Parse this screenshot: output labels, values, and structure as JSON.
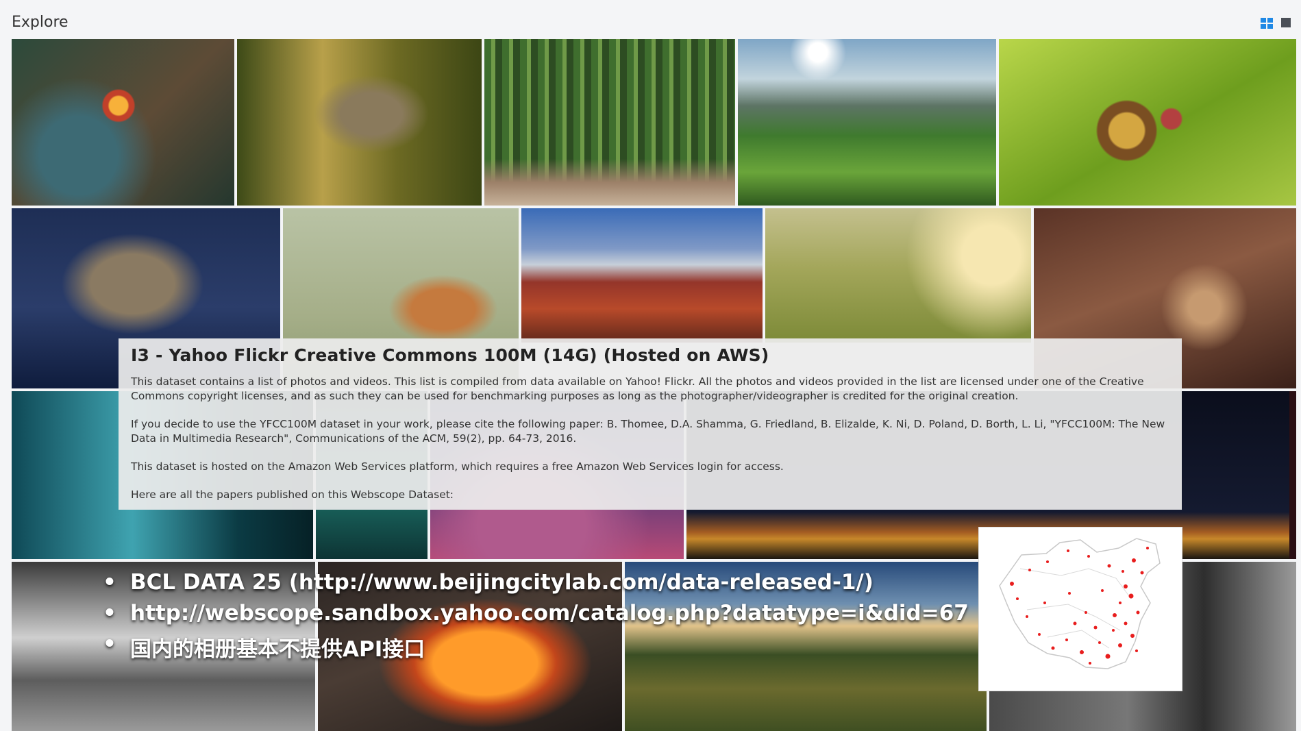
{
  "header": {
    "title": "Explore"
  },
  "view_modes": [
    "grid-view-icon",
    "single-view-icon"
  ],
  "accent_color": "#1e88e5",
  "dataset": {
    "title": "I3 - Yahoo Flickr Creative Commons 100M (14G) (Hosted on AWS)",
    "paragraph_1": "This dataset contains a list of photos and videos. This list is compiled from data available on Yahoo! Flickr. All the photos and videos provided in the list are licensed under one of the Creative Commons copyright licenses, and as such they can be used for benchmarking purposes as long as the photographer/videographer is credited for the original creation.",
    "paragraph_2": "If you decide to use the YFCC100M dataset in your work, please cite the following paper: B. Thomee, D.A. Shamma, G. Friedland, B. Elizalde, K. Ni, D. Poland, D. Borth, L. Li, \"YFCC100M: The New Data in Multimedia Research\", Communications of the ACM, 59(2), pp. 64-73, 2016.",
    "paragraph_3": "This dataset is hosted on the Amazon Web Services platform, which requires a free Amazon Web Services login for access.",
    "paragraph_4": "Here are all the papers published on this Webscope Dataset:"
  },
  "bullets": [
    "BCL DATA 25 (http://www.beijingcitylab.com/data-released-1/)",
    "http://webscope.sandbox.yahoo.com/catalog.php?datatype=i&did=67",
    "国内的相册基本不提供API接口"
  ],
  "bullet_symbol": "•"
}
